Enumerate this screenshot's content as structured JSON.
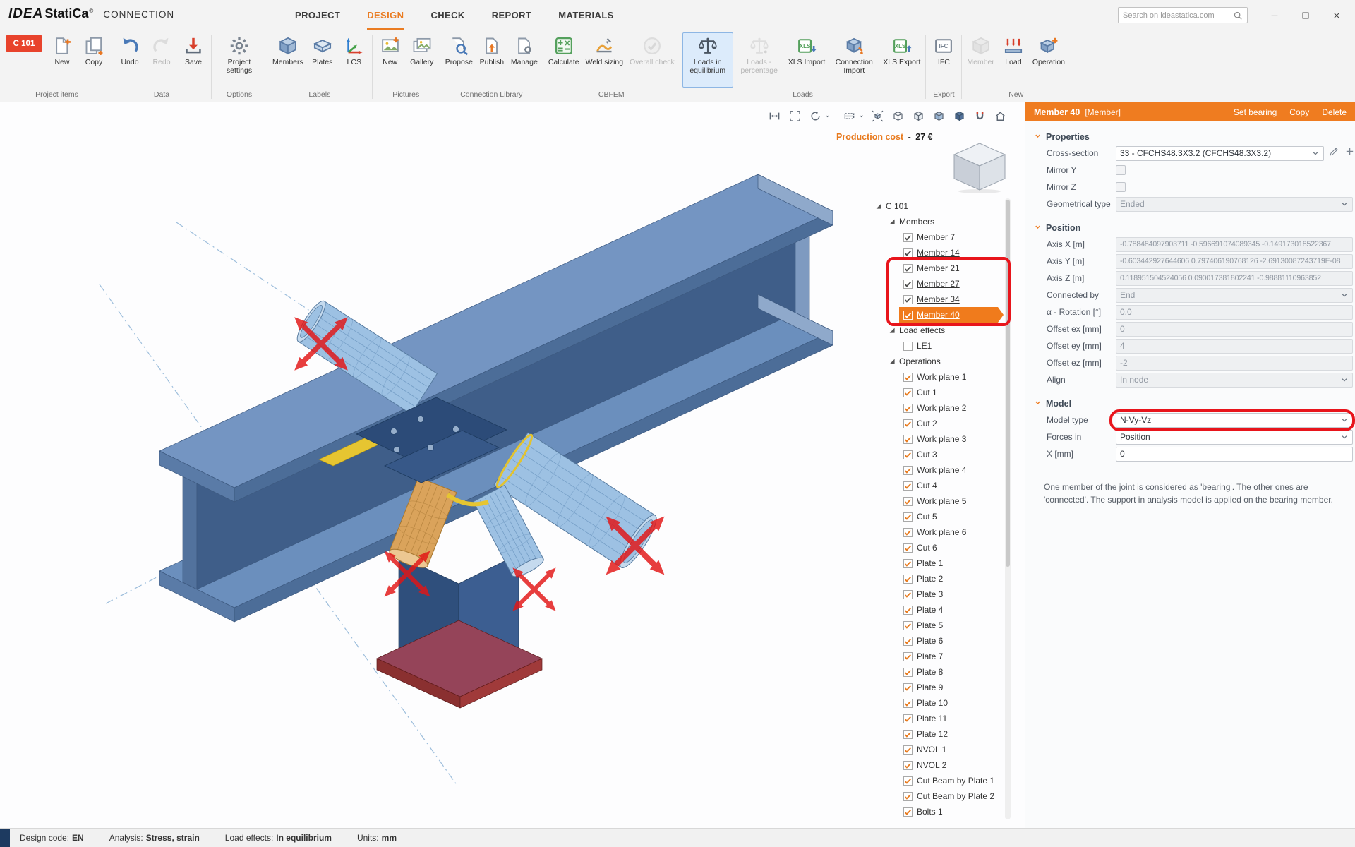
{
  "titlebar": {
    "logo": {
      "idea": "IDEA",
      "statica": "StatiCa",
      "reg": "®",
      "app": "CONNECTION"
    },
    "menu": [
      {
        "label": "PROJECT",
        "active": false
      },
      {
        "label": "DESIGN",
        "active": true
      },
      {
        "label": "CHECK",
        "active": false
      },
      {
        "label": "REPORT",
        "active": false
      },
      {
        "label": "MATERIALS",
        "active": false
      }
    ],
    "search_placeholder": "Search on ideastatica.com"
  },
  "ribbon": {
    "groups": [
      {
        "label": "Project items",
        "items": [
          {
            "label": "C 101",
            "style": "badge"
          },
          {
            "label": "New",
            "icon": "item-new"
          },
          {
            "label": "Copy",
            "icon": "item-copy"
          }
        ]
      },
      {
        "label": "Data",
        "items": [
          {
            "label": "Undo",
            "icon": "undo"
          },
          {
            "label": "Redo",
            "icon": "redo",
            "disabled": true
          },
          {
            "label": "Save",
            "icon": "save"
          }
        ]
      },
      {
        "label": "Options",
        "items": [
          {
            "label": "Project settings",
            "icon": "gear"
          }
        ]
      },
      {
        "label": "Labels",
        "items": [
          {
            "label": "Members",
            "icon": "members"
          },
          {
            "label": "Plates",
            "icon": "plates"
          },
          {
            "label": "LCS",
            "icon": "lcs"
          }
        ]
      },
      {
        "label": "Pictures",
        "items": [
          {
            "label": "New",
            "icon": "picture-new"
          },
          {
            "label": "Gallery",
            "icon": "gallery"
          }
        ]
      },
      {
        "label": "Connection Library",
        "items": [
          {
            "label": "Propose",
            "icon": "propose"
          },
          {
            "label": "Publish",
            "icon": "publish"
          },
          {
            "label": "Manage",
            "icon": "manage"
          }
        ]
      },
      {
        "label": "CBFEM",
        "items": [
          {
            "label": "Calculate",
            "icon": "calculate"
          },
          {
            "label": "Weld sizing",
            "icon": "weld"
          },
          {
            "label": "Overall check",
            "icon": "overall-check",
            "disabled": true
          }
        ]
      },
      {
        "label": "Loads",
        "items": [
          {
            "label": "Loads in equilibrium",
            "icon": "scales",
            "active": true
          },
          {
            "label": "Loads - percentage",
            "icon": "scales-gray",
            "disabled": true
          },
          {
            "label": "XLS Import",
            "icon": "xls-import"
          },
          {
            "label": "Connection Import",
            "icon": "conn-import"
          },
          {
            "label": "XLS Export",
            "icon": "xls-export"
          }
        ]
      },
      {
        "label": "Export",
        "items": [
          {
            "label": "IFC",
            "icon": "ifc"
          }
        ]
      },
      {
        "label": "New",
        "items": [
          {
            "label": "Member",
            "icon": "member-new",
            "disabled": true
          },
          {
            "label": "Load",
            "icon": "load-new"
          },
          {
            "label": "Operation",
            "icon": "operation-new"
          }
        ]
      }
    ]
  },
  "viewport": {
    "production_cost_label": "Production cost",
    "production_cost_sep": "-",
    "production_cost_value": "27 €",
    "toolbar": [
      {
        "name": "fit-width-icon",
        "icon": "vt-fit-width"
      },
      {
        "name": "zoom-extents-icon",
        "icon": "vt-fit"
      },
      {
        "name": "rotate-view-icon",
        "icon": "vt-rotate",
        "chevron": true
      },
      {
        "sep": true
      },
      {
        "name": "section-plane-icon",
        "icon": "vt-section",
        "chevron": true
      },
      {
        "name": "explode-view-icon",
        "icon": "vt-explode"
      },
      {
        "name": "wireframe-view-icon",
        "icon": "vt-wire"
      },
      {
        "name": "hidden-line-view-icon",
        "icon": "vt-hidden"
      },
      {
        "name": "shaded-view-icon",
        "icon": "vt-shaded"
      },
      {
        "name": "solid-view-icon",
        "icon": "vt-solid"
      },
      {
        "name": "magnet-icon",
        "icon": "vt-magnet"
      },
      {
        "name": "home-view-icon",
        "icon": "vt-home"
      }
    ]
  },
  "tree": {
    "items": [
      {
        "label": "C 101",
        "level": 0,
        "expander": true
      },
      {
        "label": "Members",
        "level": 1,
        "expander": true
      },
      {
        "label": "Member 7",
        "level": 2,
        "check": "dark",
        "member": true
      },
      {
        "label": "Member 14",
        "level": 2,
        "check": "dark",
        "member": true
      },
      {
        "label": "Member 21",
        "level": 2,
        "check": "dark",
        "member": true
      },
      {
        "label": "Member 27",
        "level": 2,
        "check": "dark",
        "member": true
      },
      {
        "label": "Member 34",
        "level": 2,
        "check": "dark",
        "member": true
      },
      {
        "label": "Member 40",
        "level": 2,
        "check": "dark",
        "member": true,
        "selected": true
      },
      {
        "label": "Load effects",
        "level": 1,
        "expander": true
      },
      {
        "label": "LE1",
        "level": 2,
        "check": "none"
      },
      {
        "label": "Operations",
        "level": 1,
        "expander": true
      },
      {
        "label": "Work plane 1",
        "level": 2,
        "check": "orange"
      },
      {
        "label": "Cut 1",
        "level": 2,
        "check": "orange"
      },
      {
        "label": "Work plane 2",
        "level": 2,
        "check": "orange"
      },
      {
        "label": "Cut 2",
        "level": 2,
        "check": "orange"
      },
      {
        "label": "Work plane 3",
        "level": 2,
        "check": "orange"
      },
      {
        "label": "Cut 3",
        "level": 2,
        "check": "orange"
      },
      {
        "label": "Work plane 4",
        "level": 2,
        "check": "orange"
      },
      {
        "label": "Cut 4",
        "level": 2,
        "check": "orange"
      },
      {
        "label": "Work plane 5",
        "level": 2,
        "check": "orange"
      },
      {
        "label": "Cut 5",
        "level": 2,
        "check": "orange"
      },
      {
        "label": "Work plane 6",
        "level": 2,
        "check": "orange"
      },
      {
        "label": "Cut 6",
        "level": 2,
        "check": "orange"
      },
      {
        "label": "Plate 1",
        "level": 2,
        "check": "orange"
      },
      {
        "label": "Plate 2",
        "level": 2,
        "check": "orange"
      },
      {
        "label": "Plate 3",
        "level": 2,
        "check": "orange"
      },
      {
        "label": "Plate 4",
        "level": 2,
        "check": "orange"
      },
      {
        "label": "Plate 5",
        "level": 2,
        "check": "orange"
      },
      {
        "label": "Plate 6",
        "level": 2,
        "check": "orange"
      },
      {
        "label": "Plate 7",
        "level": 2,
        "check": "orange"
      },
      {
        "label": "Plate 8",
        "level": 2,
        "check": "orange"
      },
      {
        "label": "Plate 9",
        "level": 2,
        "check": "orange"
      },
      {
        "label": "Plate 10",
        "level": 2,
        "check": "orange"
      },
      {
        "label": "Plate 11",
        "level": 2,
        "check": "orange"
      },
      {
        "label": "Plate 12",
        "level": 2,
        "check": "orange"
      },
      {
        "label": "NVOL 1",
        "level": 2,
        "check": "orange"
      },
      {
        "label": "NVOL 2",
        "level": 2,
        "check": "orange"
      },
      {
        "label": "Cut Beam by Plate 1",
        "level": 2,
        "check": "orange"
      },
      {
        "label": "Cut Beam by Plate 2",
        "level": 2,
        "check": "orange"
      },
      {
        "label": "Bolts 1",
        "level": 2,
        "check": "orange"
      }
    ]
  },
  "properties": {
    "header": {
      "title": "Member 40",
      "subtitle": "[Member]",
      "actions": [
        "Set bearing",
        "Copy",
        "Delete"
      ]
    },
    "sections": [
      {
        "title": "Properties",
        "rows": [
          {
            "label": "Cross-section",
            "control": "select",
            "value": "33 - CFCHS48.3X3.2 (CFCHS48.3X3.2)",
            "narrow": true,
            "extras": [
              "pencil-icon",
              "plus-icon"
            ]
          },
          {
            "label": "Mirror Y",
            "control": "checkbox",
            "checked": false
          },
          {
            "label": "Mirror Z",
            "control": "checkbox",
            "checked": false
          },
          {
            "label": "Geometrical type",
            "control": "select",
            "value": "Ended",
            "disabled": true
          }
        ]
      },
      {
        "title": "Position",
        "rows": [
          {
            "label": "Axis X [m]",
            "control": "input",
            "value": "-0.788484097903711 -0.596691074089345 -0.149173018522367",
            "disabled": true,
            "long": true
          },
          {
            "label": "Axis Y [m]",
            "control": "input",
            "value": "-0.603442927644606 0.797406190768126 -2.69130087243719E-08",
            "disabled": true,
            "long": true
          },
          {
            "label": "Axis Z [m]",
            "control": "input",
            "value": "0.118951504524056 0.090017381802241 -0.98881110963852",
            "disabled": true,
            "long": true
          },
          {
            "label": "Connected by",
            "control": "select",
            "value": "End",
            "disabled": true
          },
          {
            "label": "α - Rotation [°]",
            "control": "input",
            "value": "0.0",
            "disabled": true
          },
          {
            "label": "Offset ex [mm]",
            "control": "input",
            "value": "0",
            "disabled": true
          },
          {
            "label": "Offset ey [mm]",
            "control": "input",
            "value": "4",
            "disabled": true
          },
          {
            "label": "Offset ez [mm]",
            "control": "input",
            "value": "-2",
            "disabled": true
          },
          {
            "label": "Align",
            "control": "select",
            "value": "In node",
            "disabled": true
          }
        ]
      },
      {
        "title": "Model",
        "rows": [
          {
            "label": "Model type",
            "control": "select",
            "value": "N-Vy-Vz",
            "annotated": true
          },
          {
            "label": "Forces in",
            "control": "select",
            "value": "Position"
          },
          {
            "label": "X [mm]",
            "control": "input",
            "value": "0"
          }
        ]
      }
    ],
    "info": "One member of the joint is considered as 'bearing'. The other ones are 'connected'. The support in analysis model is applied on the bearing member."
  },
  "statusbar": {
    "items": [
      {
        "label": "Design code:",
        "value": "EN"
      },
      {
        "label": "Analysis:",
        "value": "Stress, strain"
      },
      {
        "label": "Load effects:",
        "value": "In equilibrium"
      },
      {
        "label": "Units:",
        "value": "mm"
      }
    ]
  }
}
